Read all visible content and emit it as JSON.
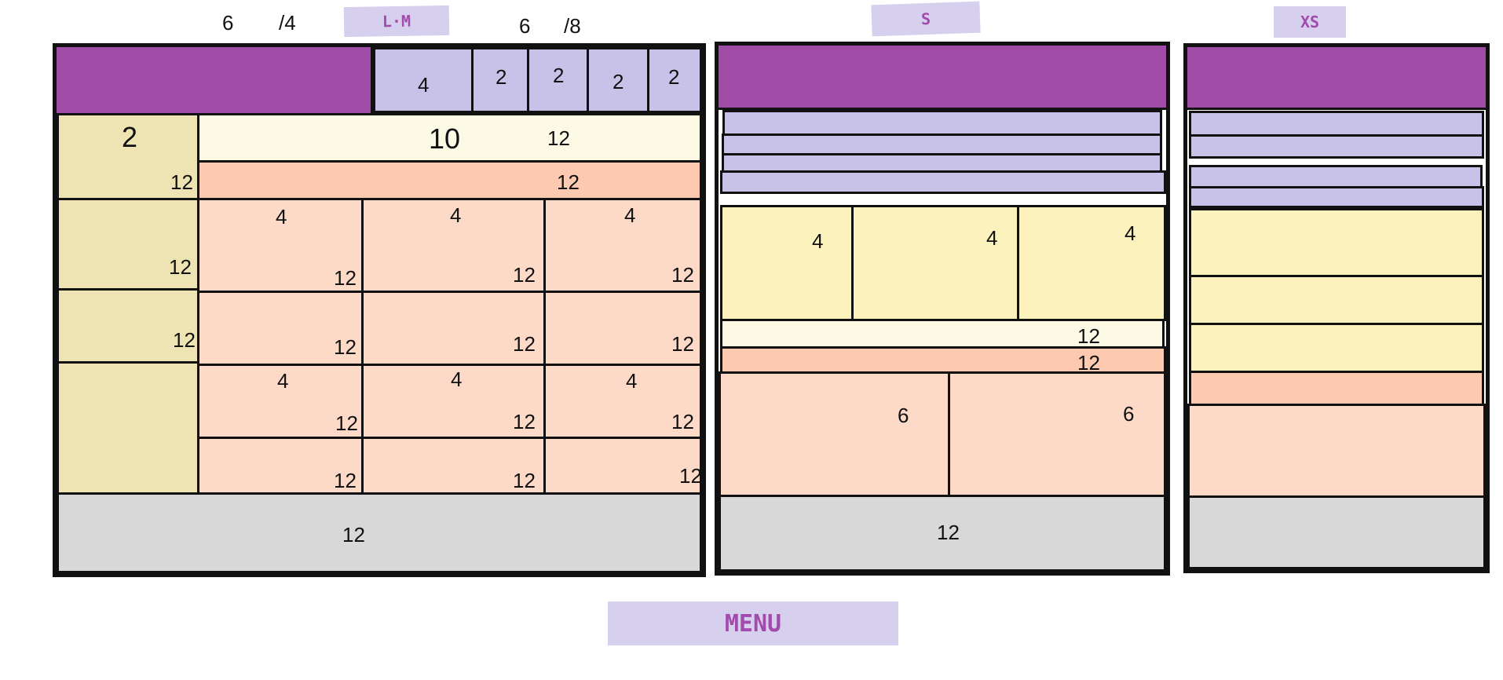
{
  "labels": {
    "lm": "L·M",
    "s": "S",
    "xs": "XS",
    "menu": "MENU",
    "col_a": "6",
    "col_a_div": "/4",
    "col_b": "6",
    "col_b_div": "/8"
  },
  "lm_panel": {
    "nav_cells": [
      "4",
      "2",
      "2",
      "2",
      "2"
    ],
    "sidebar_span": "2",
    "sidebar_rows": [
      "12",
      "12",
      "12"
    ],
    "banner_span": "10",
    "banner_row": "12",
    "strip_row": "12",
    "grid_top": [
      "4",
      "4",
      "4"
    ],
    "grid_rows": [
      [
        "12",
        "12",
        "12"
      ],
      [
        "12",
        "12",
        "12"
      ],
      [
        "12",
        "12",
        "12"
      ],
      [
        "12",
        "12",
        "12"
      ]
    ],
    "grid_mid": [
      "4",
      "4",
      "4"
    ],
    "footer": "12"
  },
  "s_panel": {
    "feature_cols": [
      "4",
      "4",
      "4"
    ],
    "banner": "12",
    "strip": "12",
    "halves": [
      "6",
      "6"
    ],
    "footer": "12"
  },
  "colors": {
    "purple": "#a04ba6",
    "lavender": "#c9c2e8",
    "khaki": "#eee3b2",
    "cream": "#fcf9e4",
    "peach": "#fdc9b0",
    "peach_light": "#fddac8",
    "yellow": "#fbf2bd",
    "gray": "#d8d8d8"
  }
}
